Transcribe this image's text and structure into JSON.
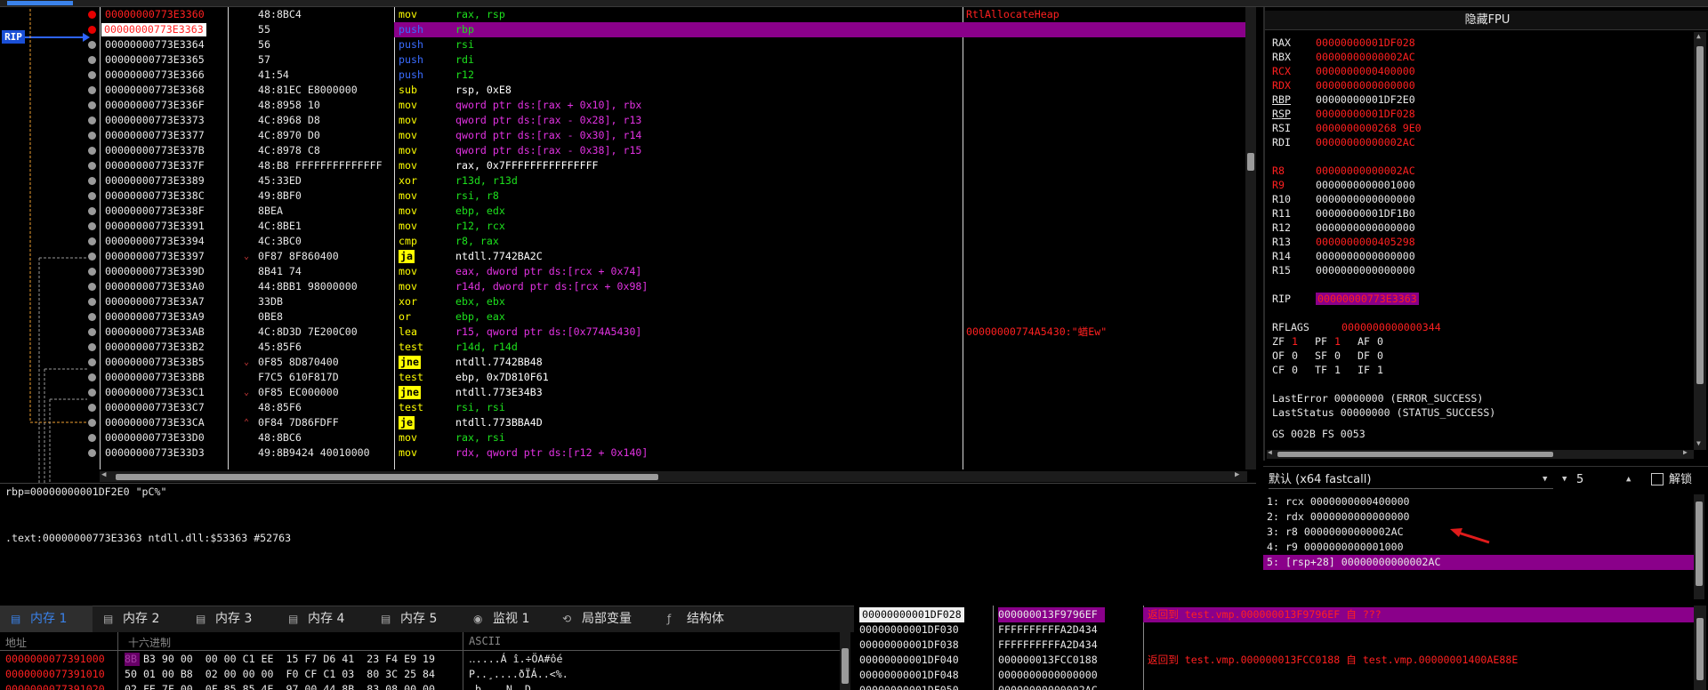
{
  "disasm": {
    "rip_label": "RIP",
    "rows": [
      {
        "addr": "00000000773E3360",
        "bytes": "48:8BC4",
        "mn": "mov",
        "ops": "rax, rsp",
        "cmt": "RtlAllocateHeap",
        "addr_style": "red",
        "mn_type": "mov",
        "bp": true,
        "op_color": "#1de11d"
      },
      {
        "addr": "00000000773E3363",
        "bytes": "55",
        "mn": "push",
        "ops": "rbp",
        "cmt": "",
        "addr_style": "rip",
        "mn_type": "push",
        "bp": true,
        "current": true,
        "op_color": "#1de11d"
      },
      {
        "addr": "00000000773E3364",
        "bytes": "56",
        "mn": "push",
        "ops": "rsi",
        "cmt": "",
        "mn_type": "push",
        "op_color": "#1de11d"
      },
      {
        "addr": "00000000773E3365",
        "bytes": "57",
        "mn": "push",
        "ops": "rdi",
        "cmt": "",
        "mn_type": "push",
        "op_color": "#1de11d"
      },
      {
        "addr": "00000000773E3366",
        "bytes": "41:54",
        "mn": "push",
        "ops": "r12",
        "cmt": "",
        "mn_type": "push",
        "op_color": "#1de11d"
      },
      {
        "addr": "00000000773E3368",
        "bytes": "48:81EC E8000000",
        "mn": "sub",
        "ops": "rsp, 0xE8",
        "cmt": "",
        "mn_type": "mov",
        "op_color": "#ffffff"
      },
      {
        "addr": "00000000773E336F",
        "bytes": "48:8958 10",
        "mn": "mov",
        "ops": "qword ptr ds:[rax + 0x10], rbx",
        "cmt": "",
        "mn_type": "mov",
        "op_color": "#e232e2"
      },
      {
        "addr": "00000000773E3373",
        "bytes": "4C:8968 D8",
        "mn": "mov",
        "ops": "qword ptr ds:[rax - 0x28], r13",
        "cmt": "",
        "mn_type": "mov",
        "op_color": "#e232e2"
      },
      {
        "addr": "00000000773E3377",
        "bytes": "4C:8970 D0",
        "mn": "mov",
        "ops": "qword ptr ds:[rax - 0x30], r14",
        "cmt": "",
        "mn_type": "mov",
        "op_color": "#e232e2"
      },
      {
        "addr": "00000000773E337B",
        "bytes": "4C:8978 C8",
        "mn": "mov",
        "ops": "qword ptr ds:[rax - 0x38], r15",
        "cmt": "",
        "mn_type": "mov",
        "op_color": "#e232e2"
      },
      {
        "addr": "00000000773E337F",
        "bytes": "48:B8 FFFFFFFFFFFFFF",
        "mn": "mov",
        "ops": "rax, 0x7FFFFFFFFFFFFFFF",
        "cmt": "",
        "mn_type": "mov",
        "op_color": "#ffffff"
      },
      {
        "addr": "00000000773E3389",
        "bytes": "45:33ED",
        "mn": "xor",
        "ops": "r13d, r13d",
        "cmt": "",
        "mn_type": "mov",
        "op_color": "#1de11d"
      },
      {
        "addr": "00000000773E338C",
        "bytes": "49:8BF0",
        "mn": "mov",
        "ops": "rsi, r8",
        "cmt": "",
        "mn_type": "mov",
        "op_color": "#1de11d"
      },
      {
        "addr": "00000000773E338F",
        "bytes": "8BEA",
        "mn": "mov",
        "ops": "ebp, edx",
        "cmt": "",
        "mn_type": "mov",
        "op_color": "#1de11d"
      },
      {
        "addr": "00000000773E3391",
        "bytes": "4C:8BE1",
        "mn": "mov",
        "ops": "r12, rcx",
        "cmt": "",
        "mn_type": "mov",
        "op_color": "#1de11d"
      },
      {
        "addr": "00000000773E3394",
        "bytes": "4C:3BC0",
        "mn": "cmp",
        "ops": "r8, rax",
        "cmt": "",
        "mn_type": "mov",
        "op_color": "#1de11d"
      },
      {
        "addr": "00000000773E3397",
        "bytes": "0F87 8F860400",
        "mn": "ja",
        "ops": "ntdll.7742BA2C",
        "cmt": "",
        "mn_type": "jcc",
        "op_color": "#ffffff",
        "arrow": "⌄"
      },
      {
        "addr": "00000000773E339D",
        "bytes": "8B41 74",
        "mn": "mov",
        "ops": "eax, dword ptr ds:[rcx + 0x74]",
        "cmt": "",
        "mn_type": "mov",
        "op_color": "#e232e2"
      },
      {
        "addr": "00000000773E33A0",
        "bytes": "44:8BB1 98000000",
        "mn": "mov",
        "ops": "r14d, dword ptr ds:[rcx + 0x98]",
        "cmt": "",
        "mn_type": "mov",
        "op_color": "#e232e2"
      },
      {
        "addr": "00000000773E33A7",
        "bytes": "33DB",
        "mn": "xor",
        "ops": "ebx, ebx",
        "cmt": "",
        "mn_type": "mov",
        "op_color": "#1de11d"
      },
      {
        "addr": "00000000773E33A9",
        "bytes": "0BE8",
        "mn": "or",
        "ops": "ebp, eax",
        "cmt": "",
        "mn_type": "mov",
        "op_color": "#1de11d"
      },
      {
        "addr": "00000000773E33AB",
        "bytes": "4C:8D3D 7E200C00",
        "mn": "lea",
        "ops": "r15, qword ptr ds:[0x774A5430]",
        "cmt": "00000000774A5430:\"蝤Ew\"",
        "mn_type": "mov",
        "op_color": "#e232e2"
      },
      {
        "addr": "00000000773E33B2",
        "bytes": "45:85F6",
        "mn": "test",
        "ops": "r14d, r14d",
        "cmt": "",
        "mn_type": "mov",
        "op_color": "#1de11d"
      },
      {
        "addr": "00000000773E33B5",
        "bytes": "0F85 8D870400",
        "mn": "jne",
        "ops": "ntdll.7742BB48",
        "cmt": "",
        "mn_type": "jcc",
        "op_color": "#ffffff",
        "arrow": "⌄"
      },
      {
        "addr": "00000000773E33BB",
        "bytes": "F7C5 610F817D",
        "mn": "test",
        "ops": "ebp, 0x7D810F61",
        "cmt": "",
        "mn_type": "mov",
        "op_color": "#ffffff"
      },
      {
        "addr": "00000000773E33C1",
        "bytes": "0F85 EC000000",
        "mn": "jne",
        "ops": "ntdll.773E34B3",
        "cmt": "",
        "mn_type": "jcc",
        "op_color": "#ffffff",
        "arrow": "⌄"
      },
      {
        "addr": "00000000773E33C7",
        "bytes": "48:85F6",
        "mn": "test",
        "ops": "rsi, rsi",
        "cmt": "",
        "mn_type": "mov",
        "op_color": "#1de11d"
      },
      {
        "addr": "00000000773E33CA",
        "bytes": "0F84 7D86FDFF",
        "mn": "je",
        "ops": "ntdll.773BBA4D",
        "cmt": "",
        "mn_type": "jcc",
        "op_color": "#ffffff",
        "arrow": "⌃"
      },
      {
        "addr": "00000000773E33D0",
        "bytes": "48:8BC6",
        "mn": "mov",
        "ops": "rax, rsi",
        "cmt": "",
        "mn_type": "mov",
        "op_color": "#1de11d"
      },
      {
        "addr": "00000000773E33D3",
        "bytes": "49:8B9424 40010000",
        "mn": "mov",
        "ops": "rdx, qword ptr ds:[r12 + 0x140]",
        "cmt": "",
        "mn_type": "mov",
        "op_color": "#e232e2"
      }
    ]
  },
  "info": {
    "line1": "rbp=00000000001DF2E0 \"pC%\"",
    "line2": ".text:00000000773E3363 ntdll.dll:$53363 #52763"
  },
  "regs": {
    "title": "隐藏FPU",
    "gp": [
      {
        "n": "RAX",
        "v": "00000000001DF028",
        "vc": "red"
      },
      {
        "n": "RBX",
        "v": "00000000000002AC",
        "vc": "red"
      },
      {
        "n": "RCX",
        "v": "0000000000400000",
        "vc": "red",
        "nc": "red"
      },
      {
        "n": "RDX",
        "v": "0000000000000000",
        "vc": "red",
        "nc": "red"
      },
      {
        "n": "RBP",
        "v": "00000000001DF2E0",
        "vc": "white",
        "ul": true
      },
      {
        "n": "RSP",
        "v": "00000000001DF028",
        "vc": "red",
        "ul": true
      },
      {
        "n": "RSI",
        "v": "0000000000268 9E0",
        "vc": "red"
      },
      {
        "n": "RDI",
        "v": "00000000000002AC",
        "vc": "red"
      }
    ],
    "ext": [
      {
        "n": "R8",
        "v": "00000000000002AC",
        "vc": "red",
        "nc": "red"
      },
      {
        "n": "R9",
        "v": "0000000000001000",
        "vc": "white",
        "nc": "red"
      },
      {
        "n": "R10",
        "v": "0000000000000000",
        "vc": "white"
      },
      {
        "n": "R11",
        "v": "00000000001DF1B0",
        "vc": "white"
      },
      {
        "n": "R12",
        "v": "0000000000000000",
        "vc": "white"
      },
      {
        "n": "R13",
        "v": "0000000000405298",
        "vc": "red"
      },
      {
        "n": "R14",
        "v": "0000000000000000",
        "vc": "white"
      },
      {
        "n": "R15",
        "v": "0000000000000000",
        "vc": "white"
      }
    ],
    "rip_name": "RIP",
    "rip_val": "00000000773E3363",
    "rflags_name": "RFLAGS",
    "rflags_val": "0000000000000344",
    "flags": [
      [
        {
          "n": "ZF",
          "v": "1",
          "r": true
        },
        {
          "n": "PF",
          "v": "1",
          "r": true
        },
        {
          "n": "AF",
          "v": "0"
        }
      ],
      [
        {
          "n": "OF",
          "v": "0"
        },
        {
          "n": "SF",
          "v": "0"
        },
        {
          "n": "DF",
          "v": "0"
        }
      ],
      [
        {
          "n": "CF",
          "v": "0"
        },
        {
          "n": "TF",
          "v": "1"
        },
        {
          "n": "IF",
          "v": "1"
        }
      ]
    ],
    "lasterror": "LastError  00000000 (ERROR_SUCCESS)",
    "laststatus": "LastStatus 00000000 (STATUS_SUCCESS)",
    "seg": "GS 002B  FS 0053"
  },
  "callconv": {
    "select": "默认 (x64 fastcall)",
    "count": "5",
    "unlock": "解锁"
  },
  "args": [
    "1: rcx 0000000000400000",
    "2: rdx 0000000000000000",
    "3: r8 00000000000002AC",
    "4: r9 0000000000001000",
    "5: [rsp+28] 00000000000002AC"
  ],
  "tabs": [
    {
      "label": "内存 1",
      "icon": "▤",
      "active": true
    },
    {
      "label": "内存 2",
      "icon": "▤"
    },
    {
      "label": "内存 3",
      "icon": "▤"
    },
    {
      "label": "内存 4",
      "icon": "▤"
    },
    {
      "label": "内存 5",
      "icon": "▤"
    },
    {
      "label": "监视 1",
      "icon": "◉"
    },
    {
      "label": "局部变量",
      "icon": "⟲"
    },
    {
      "label": "结构体",
      "icon": "ƒ"
    }
  ],
  "dump": {
    "h_addr": "地址",
    "h_hex": "十六进制",
    "h_ascii": "ASCII",
    "rows": [
      {
        "addr": "0000000077391000",
        "hex": "8B B3 90 00  00 00 C1 EE  15 F7 D6 41  23 F4 E9 19",
        "ascii": "‥....Á î.÷ÖA#ôé"
      },
      {
        "addr": "0000000077391010",
        "hex": "50 01 00 B8  02 00 00 00  F0 CF C1 03  80 3C 25 84",
        "ascii": "P..¸....ðÏÁ..<%."
      },
      {
        "addr": "0000000077391020",
        "hex": "02 FE 7F 00  0F 85 85 4E  97 00 44 8B  83 08 00 00",
        "ascii": ".þ....N..D....."
      }
    ]
  },
  "stack": {
    "rows": [
      {
        "addr": "00000000001DF028",
        "val": "000000013F9796EF",
        "cmt": "返回到 test.vmp.000000013F9796EF 自 ???",
        "sel": true
      },
      {
        "addr": "00000000001DF030",
        "val": "FFFFFFFFFFA2D434",
        "cmt": ""
      },
      {
        "addr": "00000000001DF038",
        "val": "FFFFFFFFFFA2D434",
        "cmt": ""
      },
      {
        "addr": "00000000001DF040",
        "val": "000000013FCC0188",
        "cmt": "返回到 test.vmp.000000013FCC0188 自 test.vmp.00000001400AE88E"
      },
      {
        "addr": "00000000001DF048",
        "val": "0000000000000000",
        "cmt": ""
      },
      {
        "addr": "00000000001DF050",
        "val": "00000000000002AC",
        "cmt": ""
      }
    ]
  }
}
